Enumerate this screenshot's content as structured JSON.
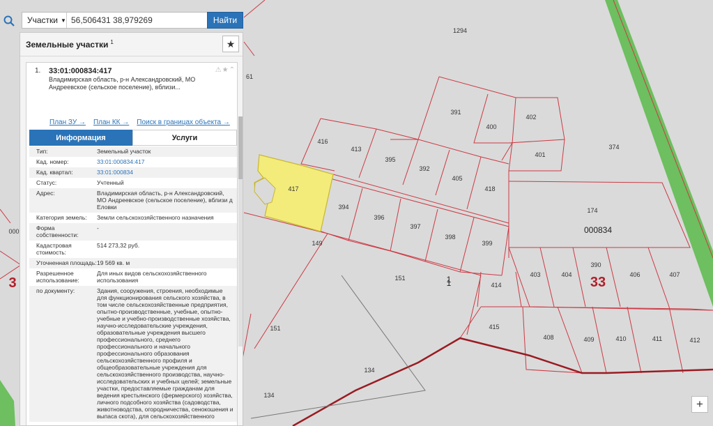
{
  "search": {
    "type_label": "Участки",
    "query": "56,506431 38,979269",
    "find_label": "Найти",
    "clear_glyph": "✕"
  },
  "panel": {
    "title": "Земельные участки",
    "title_count": "1",
    "star_glyph": "★",
    "item": {
      "number": "1.",
      "cad_number": "33:01:000834:417",
      "address_short": "Владимирская область, р-н Александровский, МО Андреевское (сельское поселение), вблизи...",
      "status_icons": "⚠★⌃"
    },
    "links": [
      "План ЗУ →",
      "План КК →",
      "Поиск в границах объекта →"
    ],
    "tabs": [
      "Информация",
      "Услуги"
    ],
    "info_rows": [
      {
        "key": "Тип:",
        "value": "Земельный участок"
      },
      {
        "key": "Кад. номер:",
        "value": "33:01:000834:417"
      },
      {
        "key": "Кад. квартал:",
        "value": "33:01:000834"
      },
      {
        "key": "Статус:",
        "value": "Учтенный"
      },
      {
        "key": "Адрес:",
        "value": "Владимирская область, р-н Александровский, МО Андреевское (сельское поселение), вблизи д Еловки"
      },
      {
        "key": "Категория земель:",
        "value": "Земли сельскохозяйственного назначения"
      },
      {
        "key": "Форма собственности:",
        "value": "-"
      },
      {
        "key": "Кадастровая стоимость:",
        "value": "514 273,32 руб."
      },
      {
        "key": "Уточненная площадь:",
        "value": "19 569 кв. м"
      },
      {
        "key": "Разрешенное использование:",
        "value": "Для иных видов сельскохозяйственного использования"
      },
      {
        "key": "по документу:",
        "value": "Здания, сооружения, строения, необходимые для функционирования сельского хозяйства, в том числе сельскохозяйственные предприятия, опытно-производственные, учебные, опытно-учебные и учебно-производственные хозяйства, научно-исследовательские учреждения, образовательные учреждения высшего профессионального, среднего профессионального и начального профессионального образования сельскохозяйственного профиля и общеобразовательные учреждения для сельскохозяйственного производства, научно-исследовательских и учебных целей; земельные участки, предоставляемые гражданам для ведения крестьянского (фермерского) хозяйства, личного подсобного хозяйства (садоводства, животноводства, огородничества, сенокошения и выпаса скота), для сельскохозяйственного"
      }
    ]
  },
  "map": {
    "zoom_in_glyph": "+",
    "colors": {
      "background": "#dadada",
      "boundary": "#cc3a44",
      "selected_fill": "#f3ec7a",
      "road": "#6dbf5f"
    },
    "plot_labels": [
      "1294",
      "391",
      "400",
      "402",
      "416",
      "413",
      "395",
      "392",
      "405",
      "418",
      "401",
      "374",
      "417",
      "394",
      "396",
      "397",
      "398",
      "399",
      "174",
      "000834",
      "390",
      "403",
      "404",
      "406",
      "407",
      "151",
      "1",
      "414",
      "415",
      "408",
      "409",
      "410",
      "411",
      "412",
      "134",
      "149",
      "151",
      "134",
      "61",
      "000"
    ],
    "quarter_labels": [
      "33",
      "3",
      "1"
    ]
  }
}
